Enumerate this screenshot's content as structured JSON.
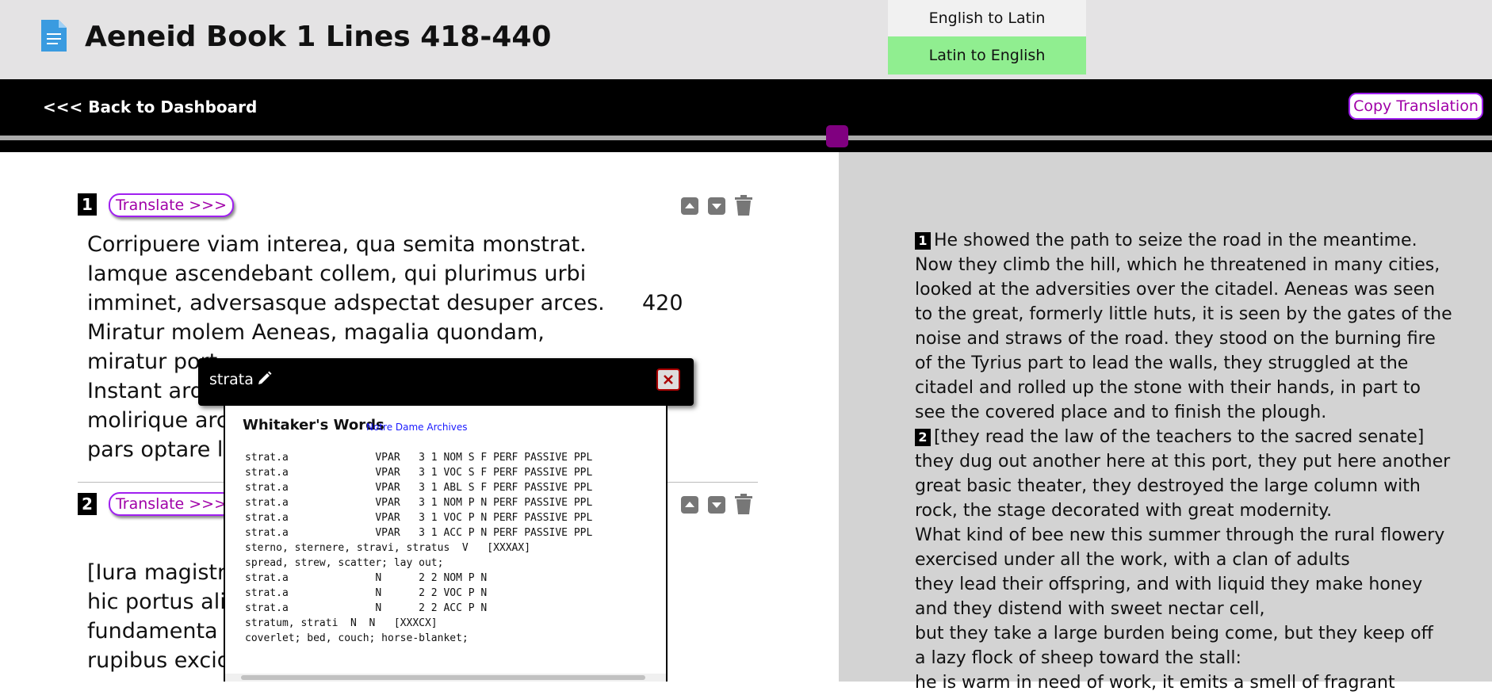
{
  "header": {
    "doc_icon": "document-icon",
    "title": "Aeneid Book 1 Lines 418-440",
    "modes": [
      "English to Latin",
      "Latin to English"
    ],
    "active_mode": "Latin to English"
  },
  "nav": {
    "back": "<<< Back to Dashboard",
    "copy": "Copy Translation"
  },
  "colors": {
    "accent": "#a020f0",
    "active_mode": "#90ee90",
    "handle": "#800080",
    "right_bg": "#d3d3d3"
  },
  "sections": [
    {
      "number": "1",
      "translate_label": "Translate >>>",
      "lines": [
        "Corripuere viam interea, qua semita monstrat.",
        "Iamque ascendebant collem, qui plurimus urbi",
        "imminet, adversasque adspectat desuper arces.",
        "Miratur molem Aeneas, magalia quondam,",
        "miratur port",
        "Instant ard",
        "molirique arc",
        "pars optare lo"
      ],
      "line_number": "420"
    },
    {
      "number": "2",
      "translate_label": "Translate >>>",
      "lines": [
        "[Iura magistra",
        "hic portus ali",
        "fundamenta l",
        "rupibus excid"
      ]
    }
  ],
  "popup": {
    "word": "strata",
    "dictionary_title": "Whitaker's Words",
    "dictionary_link": "Notre Dame Archives",
    "entries": "strat.a              VPAR   3 1 NOM S F PERF PASSIVE PPL\nstrat.a              VPAR   3 1 VOC S F PERF PASSIVE PPL\nstrat.a              VPAR   3 1 ABL S F PERF PASSIVE PPL\nstrat.a              VPAR   3 1 NOM P N PERF PASSIVE PPL\nstrat.a              VPAR   3 1 VOC P N PERF PASSIVE PPL\nstrat.a              VPAR   3 1 ACC P N PERF PASSIVE PPL\nsterno, sternere, stravi, stratus  V   [XXXAX]\nspread, strew, scatter; lay out;\nstrat.a              N      2 2 NOM P N\nstrat.a              N      2 2 VOC P N\nstrat.a              N      2 2 ACC P N\nstratum, strati  N  N   [XXXCX]\ncoverlet; bed, couch; horse-blanket;"
  },
  "translation": [
    {
      "marker": "1",
      "text": "He showed the path to seize the road in the meantime."
    },
    {
      "text": "Now they climb the hill, which he threatened in many cities,"
    },
    {
      "text": "looked at the adversities over the citadel. Aeneas was seen"
    },
    {
      "text": "to the great, formerly little huts, it is seen by the gates of the"
    },
    {
      "text": "noise and straws of the road. they stood on the burning fire"
    },
    {
      "text": "of the Tyrius part to lead the walls, they struggled at the"
    },
    {
      "text": "citadel and rolled up the stone with their hands, in part to"
    },
    {
      "text": "see the covered place and to finish the plough."
    },
    {
      "marker": "2",
      "text": "[they read the law of the teachers to the sacred senate]"
    },
    {
      "text": "they dug out another here at this port, they put here another"
    },
    {
      "text": "great basic theater, they destroyed the large column with"
    },
    {
      "text": "rock, the stage decorated with great modernity."
    },
    {
      "text": "What kind of bee new this summer through the rural flowery"
    },
    {
      "text": "exercised under all the work, with a clan of adults"
    },
    {
      "text": "they lead their offspring, and with liquid they make honey"
    },
    {
      "text": "and they distend with sweet nectar cell,"
    },
    {
      "text": "but they take a large burden being come, but they keep off"
    },
    {
      "text": "a lazy flock of sheep toward the stall:"
    },
    {
      "text": "he is warm in need of work, it emits a smell of fragrant"
    }
  ]
}
